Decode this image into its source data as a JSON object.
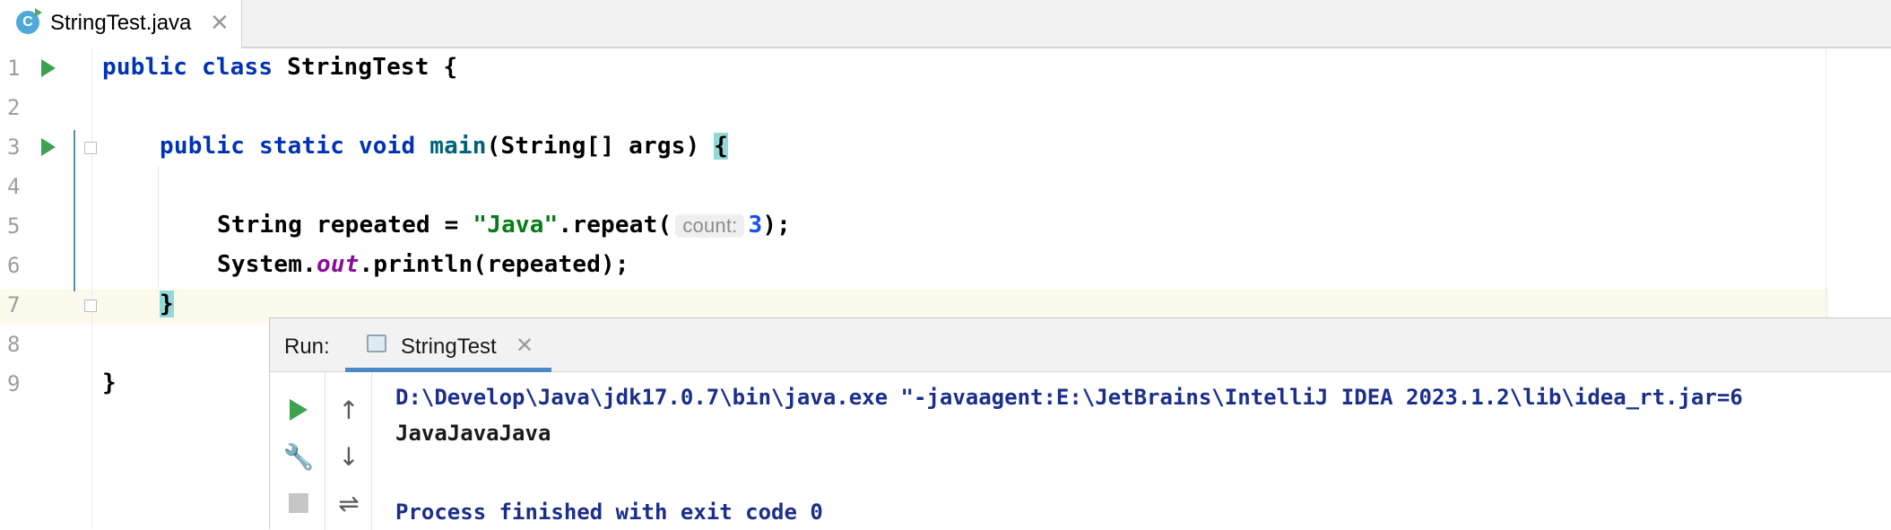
{
  "tab": {
    "title": "StringTest.java",
    "icon_letter": "C",
    "icon": "java-class-icon",
    "close": "✕"
  },
  "editor": {
    "line_numbers": [
      "1",
      "2",
      "3",
      "4",
      "5",
      "6",
      "7",
      "8",
      "9"
    ],
    "code": {
      "l1_kw": "public class ",
      "l1_rest": "StringTest {",
      "l3_kw": "public static void ",
      "l3_fn": "main",
      "l3_rest": "(String[] args) ",
      "l3_brace": "{",
      "l5_a": "String repeated = ",
      "l5_str": "\"Java\"",
      "l5_b": ".repeat(",
      "l5_hint": "count:",
      "l5_num": "3",
      "l5_c": ");",
      "l6_a": "System.",
      "l6_field": "out",
      "l6_b": ".println(repeated);",
      "l7_brace": "}",
      "l9": "}"
    }
  },
  "run": {
    "title": "Run:",
    "tab_label": "StringTest",
    "tab_close": "✕",
    "toolbar": {
      "rerun": "play-icon",
      "settings": "wrench-icon",
      "stop": "stop-icon",
      "up_glyph": "↑",
      "down_glyph": "↓",
      "wrap_glyph": "⇌",
      "wrench_glyph": "🔧"
    },
    "console": {
      "command": "D:\\Develop\\Java\\jdk17.0.7\\bin\\java.exe \"-javaagent:E:\\JetBrains\\IntelliJ IDEA 2023.1.2\\lib\\idea_rt.jar=6",
      "output": "JavaJavaJava",
      "exit": "Process finished with exit code 0"
    }
  },
  "colors": {
    "keyword": "#0033b3",
    "string": "#067d17",
    "number": "#1750eb",
    "field": "#871094",
    "run_green": "#3ca24f",
    "brace_highlight": "#93d9d9"
  }
}
